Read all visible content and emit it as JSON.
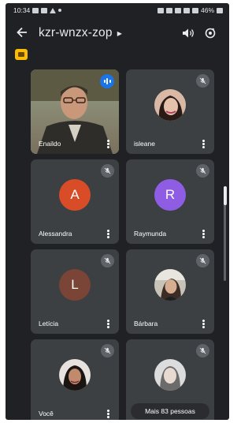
{
  "status": {
    "time": "10:34",
    "battery": "46%"
  },
  "meeting": {
    "code": "kzr-wnzx-zop"
  },
  "colors": {
    "background": "#202124",
    "tile": "#3c4043",
    "accent": "#8ab4f8",
    "speaking": "#1a73e8"
  },
  "icons": {
    "back": "arrow-left-icon",
    "audio": "speaker-icon",
    "camera": "switch-camera-icon",
    "mute": "mic-off-icon"
  },
  "participants": [
    {
      "name": "Enaildo",
      "type": "video",
      "speaking": true
    },
    {
      "name": "isleane",
      "type": "photo",
      "muted": true
    },
    {
      "name": "Alessandra",
      "initial": "A",
      "avatar_color": "#d84c28",
      "muted": true
    },
    {
      "name": "Raymunda",
      "initial": "R",
      "avatar_color": "#8e5de3",
      "muted": true
    },
    {
      "name": "Letícia",
      "initial": "L",
      "avatar_color": "#7a4436",
      "muted": true
    },
    {
      "name": "Bárbara",
      "type": "photo",
      "muted": true
    },
    {
      "name": "Você",
      "type": "photo",
      "muted": true
    }
  ],
  "more": {
    "label": "Mais 83 pessoas"
  }
}
